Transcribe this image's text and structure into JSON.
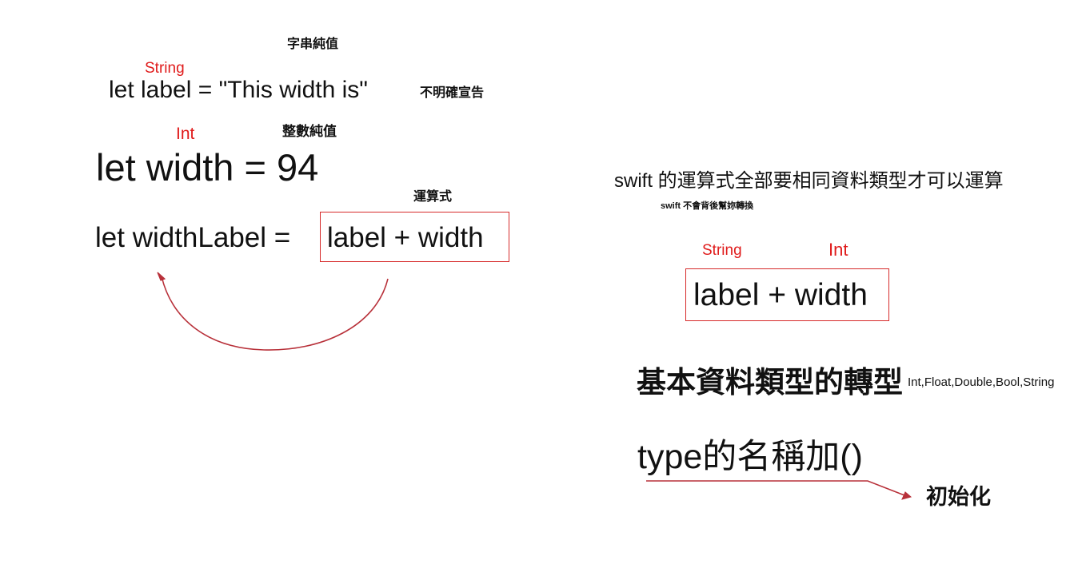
{
  "left": {
    "string_literal_note": "字串純值",
    "string_type": "String",
    "line1": "let label = \"This width is\"",
    "implicit_note": "不明確宣告",
    "int_type": "Int",
    "int_literal_note": "整數純值",
    "line2": "let width = 94",
    "expression_note": "運算式",
    "line3_prefix": "let widthLabel = ",
    "line3_expr": "label + width"
  },
  "right": {
    "rule": "swift 的運算式全部要相同資料類型才可以運算",
    "rule_sub": "swift 不會背後幫妳轉換",
    "string_type": "String",
    "int_type": "Int",
    "expr": "label + width",
    "conversion_title": "基本資料類型的轉型",
    "type_list": "Int,Float,Double,Bool,String",
    "type_init": "type的名稱加()",
    "init_note": "初始化"
  },
  "colors": {
    "accent_red": "#e01b1b",
    "arrow_red": "#b8313a",
    "text": "#111111"
  }
}
